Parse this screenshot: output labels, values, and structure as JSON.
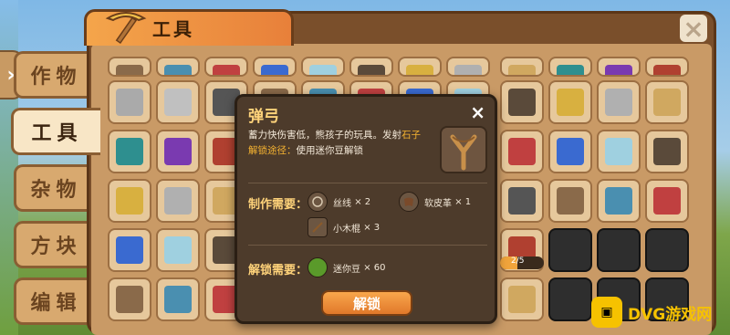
{
  "window": {
    "title": "工具",
    "close_label": "×"
  },
  "back_arrow": "›",
  "sidebar": {
    "tabs": [
      {
        "label": "作物",
        "active": false
      },
      {
        "label": "工具",
        "active": true
      },
      {
        "label": "杂物",
        "active": false
      },
      {
        "label": "方块",
        "active": false
      },
      {
        "label": "编辑",
        "active": false
      }
    ]
  },
  "popup": {
    "title": "弹弓",
    "close_label": "×",
    "description_prefix": "蓄力快伤害低，熊孩子的玩具。发射",
    "description_highlight": "石子",
    "unlock_path_label": "解锁途径：",
    "unlock_path_value": "使用迷你豆解锁",
    "craft_label": "制作需要：",
    "materials": [
      {
        "name": "丝线",
        "qty": "× 2",
        "icon": "string-icon"
      },
      {
        "name": "软皮革",
        "qty": "× 1",
        "icon": "leather-icon"
      },
      {
        "name": "小木棍",
        "qty": "× 3",
        "icon": "stick-icon"
      }
    ],
    "unlock_label": "解锁需要：",
    "unlock_cost": {
      "name": "迷你豆",
      "qty": "× 60",
      "icon": "mini-bean-icon"
    },
    "unlock_button": "解锁"
  },
  "progress": {
    "text": "2/5",
    "fraction": 0.4
  },
  "watermark": {
    "text": "DVG游戏网"
  },
  "colors": {
    "accent": "#f0a43b",
    "title_yellow": "#ffd37a",
    "panel_brown": "#7a4f2b"
  }
}
